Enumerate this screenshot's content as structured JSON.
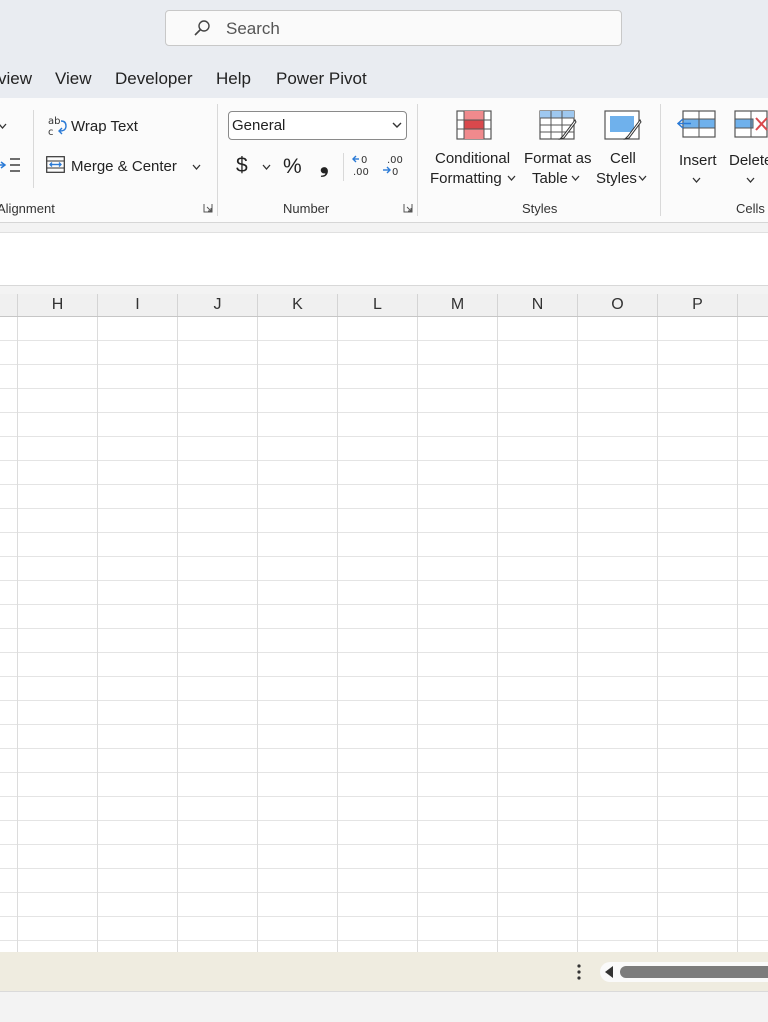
{
  "search": {
    "placeholder": "Search"
  },
  "menu": {
    "items": [
      "view",
      "View",
      "Developer",
      "Help",
      "Power Pivot"
    ]
  },
  "ribbon": {
    "alignment": {
      "wrap_text": "Wrap Text",
      "merge_center": "Merge & Center",
      "label": "Alignment"
    },
    "number": {
      "format": "General",
      "currency": "$",
      "percent": "%",
      "comma": "❟",
      "label": "Number"
    },
    "styles": {
      "conditional": [
        "Conditional",
        "Formatting"
      ],
      "format_table": [
        "Format as",
        "Table"
      ],
      "cell_styles": [
        "Cell",
        "Styles"
      ],
      "label": "Styles"
    },
    "cells": {
      "insert": "Insert",
      "delete": "Delete",
      "label": "Cells"
    }
  },
  "grid": {
    "columns": [
      "H",
      "I",
      "J",
      "K",
      "L",
      "M",
      "N",
      "O",
      "P"
    ]
  },
  "colors": {
    "accent_blue": "#2a7ad6",
    "red": "#d9484c",
    "status_bar": "#efece0"
  }
}
